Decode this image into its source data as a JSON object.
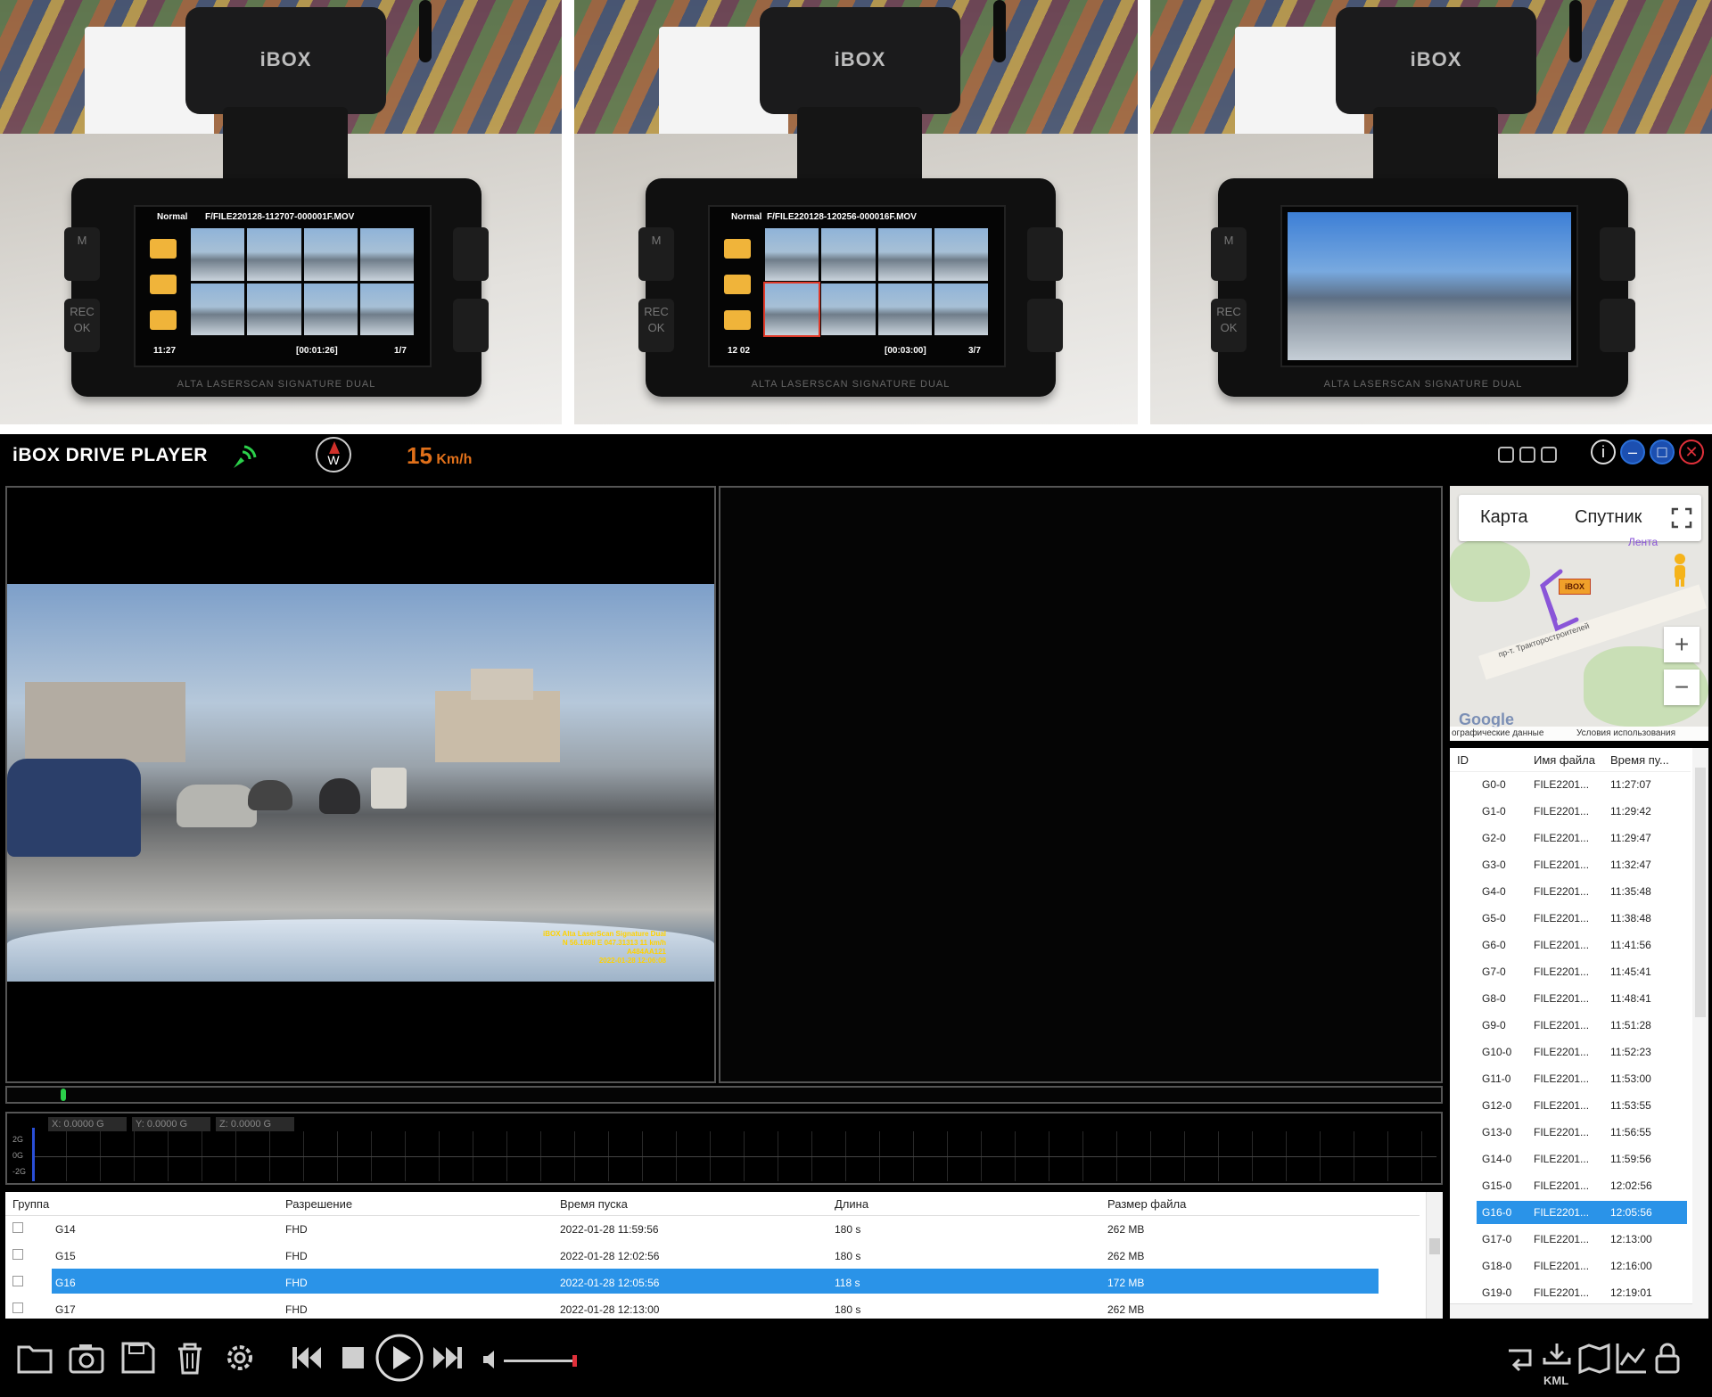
{
  "photos": [
    {
      "brand": "iBOX",
      "mode": "Normal",
      "file": "F/FILE220128-112707-000001F.MOV",
      "clock": "11:27",
      "duration": "[00:01:26]",
      "page": "1/7",
      "caption": "ALTA LASERSCAN SIGNATURE DUAL"
    },
    {
      "brand": "iBOX",
      "mode": "Normal",
      "file": "F/FILE220128-120256-000016F.MOV",
      "clock": "12 02",
      "duration": "[00:03:00]",
      "page": "3/7",
      "caption": "ALTA LASERSCAN SIGNATURE DUAL"
    },
    {
      "brand": "iBOX",
      "caption": "ALTA LASERSCAN SIGNATURE DUAL"
    }
  ],
  "player": {
    "title": "iBOX DRIVE PLAYER",
    "compass_letter": "W",
    "speed_value": "15",
    "speed_unit": "Km/h",
    "video_stamp": {
      "line1": "iBOX Alta LaserScan Signature Dual",
      "line2": "N 56.1698  E 047.31313  11 km/h",
      "line3": "A484AA121",
      "line4": "2022-01-28 12:06:08"
    },
    "gsensor": {
      "x": "X: 0.0000 G",
      "y": "Y: 0.0000 G",
      "z": "Z: 0.0000 G",
      "labels": [
        "2G",
        "0G",
        "-2G"
      ]
    },
    "file_table": {
      "headers": [
        "Группа",
        "Разрешение",
        "Время пуска",
        "Длина",
        "Размер файла"
      ],
      "rows": [
        {
          "group": "G14",
          "res": "FHD",
          "start": "2022-01-28 11:59:56",
          "length": "180 s",
          "size": "262 MB",
          "selected": false
        },
        {
          "group": "G15",
          "res": "FHD",
          "start": "2022-01-28 12:02:56",
          "length": "180 s",
          "size": "262 MB",
          "selected": false
        },
        {
          "group": "G16",
          "res": "FHD",
          "start": "2022-01-28 12:05:56",
          "length": "118 s",
          "size": "172 MB",
          "selected": true
        },
        {
          "group": "G17",
          "res": "FHD",
          "start": "2022-01-28 12:13:00",
          "length": "180 s",
          "size": "262 MB",
          "selected": false
        }
      ]
    },
    "map": {
      "tab_map": "Карта",
      "tab_sat": "Спутник",
      "place": "Лента",
      "street": "пр-т. Тракторостроителей",
      "marker": "iBOX",
      "google": "Google",
      "footer_left": "ографические данные",
      "footer_right": "Условия использования",
      "zoom_in": "+",
      "zoom_out": "−"
    },
    "list": {
      "headers": [
        "ID",
        "Имя файла",
        "Время пу..."
      ],
      "rows": [
        {
          "id": "G0-0",
          "name": "FILE2201...",
          "time": "11:27:07",
          "selected": false
        },
        {
          "id": "G1-0",
          "name": "FILE2201...",
          "time": "11:29:42",
          "selected": false
        },
        {
          "id": "G2-0",
          "name": "FILE2201...",
          "time": "11:29:47",
          "selected": false
        },
        {
          "id": "G3-0",
          "name": "FILE2201...",
          "time": "11:32:47",
          "selected": false
        },
        {
          "id": "G4-0",
          "name": "FILE2201...",
          "time": "11:35:48",
          "selected": false
        },
        {
          "id": "G5-0",
          "name": "FILE2201...",
          "time": "11:38:48",
          "selected": false
        },
        {
          "id": "G6-0",
          "name": "FILE2201...",
          "time": "11:41:56",
          "selected": false
        },
        {
          "id": "G7-0",
          "name": "FILE2201...",
          "time": "11:45:41",
          "selected": false
        },
        {
          "id": "G8-0",
          "name": "FILE2201...",
          "time": "11:48:41",
          "selected": false
        },
        {
          "id": "G9-0",
          "name": "FILE2201...",
          "time": "11:51:28",
          "selected": false
        },
        {
          "id": "G10-0",
          "name": "FILE2201...",
          "time": "11:52:23",
          "selected": false
        },
        {
          "id": "G11-0",
          "name": "FILE2201...",
          "time": "11:53:00",
          "selected": false
        },
        {
          "id": "G12-0",
          "name": "FILE2201...",
          "time": "11:53:55",
          "selected": false
        },
        {
          "id": "G13-0",
          "name": "FILE2201...",
          "time": "11:56:55",
          "selected": false
        },
        {
          "id": "G14-0",
          "name": "FILE2201...",
          "time": "11:59:56",
          "selected": false
        },
        {
          "id": "G15-0",
          "name": "FILE2201...",
          "time": "12:02:56",
          "selected": false
        },
        {
          "id": "G16-0",
          "name": "FILE2201...",
          "time": "12:05:56",
          "selected": true
        },
        {
          "id": "G17-0",
          "name": "FILE2201...",
          "time": "12:13:00",
          "selected": false
        },
        {
          "id": "G18-0",
          "name": "FILE2201...",
          "time": "12:16:00",
          "selected": false
        },
        {
          "id": "G19-0",
          "name": "FILE2201...",
          "time": "12:19:01",
          "selected": false
        }
      ]
    },
    "kml_label": "KML",
    "colors": {
      "selection": "#2a93e8",
      "speed": "#e0701a",
      "gps": "#2bd04a",
      "close": "#e0303a",
      "window_buttons": "#2a6fd8"
    }
  }
}
